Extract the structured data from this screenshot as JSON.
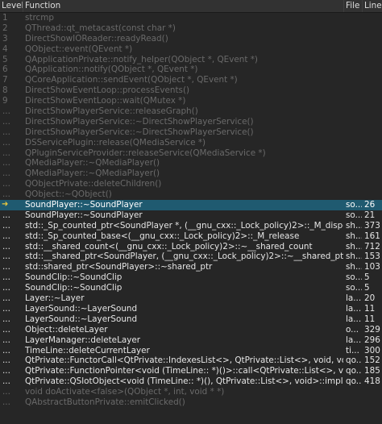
{
  "header": {
    "level": "Level",
    "function": "Function",
    "file": "File",
    "line": "Line"
  },
  "frames": [
    {
      "level": "1",
      "function": "strcmp",
      "file": "",
      "line": "",
      "muted": true
    },
    {
      "level": "2",
      "function": "QThread::qt_metacast(const char *)",
      "file": "",
      "line": "",
      "muted": true
    },
    {
      "level": "3",
      "function": "DirectShowIOReader::readyRead()",
      "file": "",
      "line": "",
      "muted": true
    },
    {
      "level": "4",
      "function": "QObject::event(QEvent *)",
      "file": "",
      "line": "",
      "muted": true
    },
    {
      "level": "5",
      "function": "QApplicationPrivate::notify_helper(QObject *, QEvent *)",
      "file": "",
      "line": "",
      "muted": true
    },
    {
      "level": "6",
      "function": "QApplication::notify(QObject *, QEvent *)",
      "file": "",
      "line": "",
      "muted": true
    },
    {
      "level": "7",
      "function": "QCoreApplication::sendEvent(QObject *, QEvent *)",
      "file": "",
      "line": "",
      "muted": true
    },
    {
      "level": "8",
      "function": "DirectShowEventLoop::processEvents()",
      "file": "",
      "line": "",
      "muted": true
    },
    {
      "level": "9",
      "function": "DirectShowEventLoop::wait(QMutex *)",
      "file": "",
      "line": "",
      "muted": true
    },
    {
      "level": "...",
      "function": "DirectShowPlayerService::releaseGraph()",
      "file": "",
      "line": "",
      "muted": true
    },
    {
      "level": "...",
      "function": "DirectShowPlayerService::~DirectShowPlayerService()",
      "file": "",
      "line": "",
      "muted": true
    },
    {
      "level": "...",
      "function": "DirectShowPlayerService::~DirectShowPlayerService()",
      "file": "",
      "line": "",
      "muted": true
    },
    {
      "level": "...",
      "function": "DSServicePlugin::release(QMediaService *)",
      "file": "",
      "line": "",
      "muted": true
    },
    {
      "level": "...",
      "function": "QPluginServiceProvider::releaseService(QMediaService *)",
      "file": "",
      "line": "",
      "muted": true
    },
    {
      "level": "...",
      "function": "QMediaPlayer::~QMediaPlayer()",
      "file": "",
      "line": "",
      "muted": true
    },
    {
      "level": "...",
      "function": "QMediaPlayer::~QMediaPlayer()",
      "file": "",
      "line": "",
      "muted": true
    },
    {
      "level": "...",
      "function": "QObjectPrivate::deleteChildren()",
      "file": "",
      "line": "",
      "muted": true
    },
    {
      "level": "...",
      "function": "QObject::~QObject()",
      "file": "",
      "line": "",
      "muted": true
    },
    {
      "level": "",
      "function": "SoundPlayer::~SoundPlayer",
      "file": "so...",
      "line": "26",
      "selected": true,
      "marker": "➜"
    },
    {
      "level": "...",
      "function": "SoundPlayer::~SoundPlayer",
      "file": "so...",
      "line": "21"
    },
    {
      "level": "...",
      "function": "std::_Sp_counted_ptr<SoundPlayer *, (__gnu_cxx::_Lock_policy)2>::_M_dispose",
      "file": "sh...",
      "line": "373"
    },
    {
      "level": "...",
      "function": "std::_Sp_counted_base<(__gnu_cxx::_Lock_policy)2>::_M_release",
      "file": "sh...",
      "line": "161"
    },
    {
      "level": "...",
      "function": "std::__shared_count<(__gnu_cxx::_Lock_policy)2>::~__shared_count",
      "file": "sh...",
      "line": "712"
    },
    {
      "level": "...",
      "function": "std::__shared_ptr<SoundPlayer, (__gnu_cxx::_Lock_policy)2>::~__shared_ptr",
      "file": "sh...",
      "line": "153"
    },
    {
      "level": "...",
      "function": "std::shared_ptr<SoundPlayer>::~shared_ptr",
      "file": "sh...",
      "line": "103"
    },
    {
      "level": "...",
      "function": "SoundClip::~SoundClip",
      "file": "so...",
      "line": "5"
    },
    {
      "level": "...",
      "function": "SoundClip::~SoundClip",
      "file": "so...",
      "line": "5"
    },
    {
      "level": "...",
      "function": "Layer::~Layer",
      "file": "la...",
      "line": "20"
    },
    {
      "level": "...",
      "function": "LayerSound::~LayerSound",
      "file": "la...",
      "line": "11"
    },
    {
      "level": "...",
      "function": "LayerSound::~LayerSound",
      "file": "la...",
      "line": "11"
    },
    {
      "level": "...",
      "function": "Object::deleteLayer",
      "file": "o...",
      "line": "329"
    },
    {
      "level": "...",
      "function": "LayerManager::deleteLayer",
      "file": "la...",
      "line": "296"
    },
    {
      "level": "...",
      "function": "TimeLine::deleteCurrentLayer",
      "file": "ti...",
      "line": "300"
    },
    {
      "level": "...",
      "function": "QtPrivate::FunctorCall<QtPrivate::IndexesList<>, QtPrivate::List<>, void, void (TimeLine::...",
      "file": "qo...",
      "line": "152"
    },
    {
      "level": "...",
      "function": "QtPrivate::FunctionPointer<void (TimeLine:: *)()>::call<QtPrivate::List<>, void>",
      "file": "qo...",
      "line": "185"
    },
    {
      "level": "...",
      "function": "QtPrivate::QSlotObject<void (TimeLine:: *)(), QtPrivate::List<>, void>::impl(int, QtPrivate...",
      "file": "qo...",
      "line": "418"
    },
    {
      "level": "...",
      "function": "void doActivate<false>(QObject *, int, void * *)",
      "file": "",
      "line": "",
      "muted": true
    },
    {
      "level": "...",
      "function": "QAbstractButtonPrivate::emitClicked()",
      "file": "",
      "line": "",
      "muted": true
    }
  ],
  "colors": {
    "background": "#262626",
    "header": "#323232",
    "selection": "#1f5a70",
    "muted_text": "#6a6a6a",
    "marker": "#e8c840"
  }
}
